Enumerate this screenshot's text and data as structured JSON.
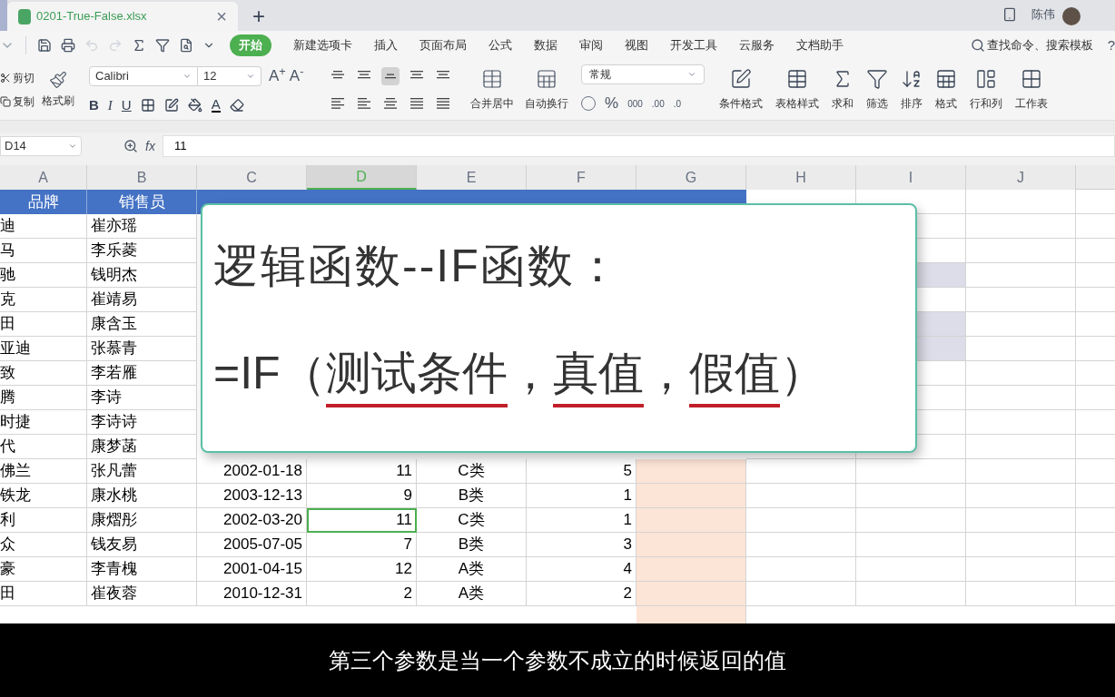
{
  "document_tab": {
    "title": "0201-True-False.xlsx",
    "close": "×"
  },
  "new_tab": "+",
  "user": {
    "name": "陈伟"
  },
  "menu_tabs": [
    {
      "label": "开始",
      "selected": true
    },
    {
      "label": "新建选项卡",
      "selected": false
    },
    {
      "label": "插入",
      "selected": false
    },
    {
      "label": "页面布局",
      "selected": false
    },
    {
      "label": "公式",
      "selected": false
    },
    {
      "label": "数据",
      "selected": false
    },
    {
      "label": "审阅",
      "selected": false
    },
    {
      "label": "视图",
      "selected": false
    },
    {
      "label": "开发工具",
      "selected": false
    },
    {
      "label": "云服务",
      "selected": false
    },
    {
      "label": "文档助手",
      "selected": false
    }
  ],
  "search": {
    "label": "查找命令、搜索模板",
    "help": "?"
  },
  "ribbon": {
    "cut": "剪切",
    "copy": "复制",
    "format_painter": "格式刷",
    "font": "Calibri",
    "font_size": "12",
    "grow": "A$^{+}$",
    "shrink": "A$^{-}$",
    "bold": "B",
    "italic": "I",
    "underline": "U",
    "font_color": "A",
    "align_buttons": [
      {
        "selected": false
      },
      {
        "selected": false
      },
      {
        "selected": true
      },
      {
        "selected": false
      },
      {
        "selected": false
      },
      {
        "selected": false
      },
      {
        "selected": false
      },
      {
        "selected": false
      },
      {
        "selected": false
      },
      {
        "selected": false
      }
    ],
    "merge": "合并居中",
    "wrap": "自动换行",
    "number_format": "常规",
    "percent": "%",
    "thousands": "000",
    "inc_decimal": ".00",
    "dec_decimal": ".0",
    "tools": [
      {
        "label": "条件格式",
        "kind": "conditional"
      },
      {
        "label": "表格样式",
        "kind": "table-style"
      },
      {
        "label": "求和",
        "kind": "sum"
      },
      {
        "label": "筛选",
        "kind": "filter"
      },
      {
        "label": "排序",
        "kind": "sort"
      },
      {
        "label": "格式",
        "kind": "format"
      },
      {
        "label": "行和列",
        "kind": "rows-cols"
      },
      {
        "label": "工作表",
        "kind": "sheet"
      }
    ]
  },
  "formula_bar": {
    "cell_ref": "D14",
    "fx": "fx",
    "value": "11"
  },
  "columns": [
    {
      "label": "A",
      "selected": false
    },
    {
      "label": "B",
      "selected": false
    },
    {
      "label": "C",
      "selected": false
    },
    {
      "label": "D",
      "selected": true
    },
    {
      "label": "E",
      "selected": false
    },
    {
      "label": "F",
      "selected": false
    },
    {
      "label": "G",
      "selected": false
    },
    {
      "label": "H",
      "selected": false
    },
    {
      "label": "I",
      "selected": false
    },
    {
      "label": "J",
      "selected": false
    }
  ],
  "table": {
    "header": [
      "品牌",
      "销售员"
    ],
    "rows": [
      {
        "brand": "迪",
        "seller": "崔亦瑶",
        "shaded": false
      },
      {
        "brand": "马",
        "seller": "李乐菱",
        "shaded": false
      },
      {
        "brand": "驰",
        "seller": "钱明杰",
        "shaded": true
      },
      {
        "brand": "克",
        "seller": "崔靖易",
        "shaded": false
      },
      {
        "brand": "田",
        "seller": "康含玉",
        "shaded": true
      },
      {
        "brand": "亚迪",
        "seller": "张慕青",
        "shaded": true
      },
      {
        "brand": "致",
        "seller": "李若雁",
        "shaded": false
      },
      {
        "brand": "腾",
        "seller": "李诗",
        "shaded": false
      },
      {
        "brand": "时捷",
        "seller": "李诗诗",
        "shaded": false
      },
      {
        "brand": "代",
        "seller": "康梦菡",
        "shaded": false
      },
      {
        "brand": "佛兰",
        "seller": "张凡蕾",
        "date": "2002-01-18",
        "years": "11",
        "level": "C类",
        "rating": "5",
        "selected": false,
        "shaded": false
      },
      {
        "brand": "铁龙",
        "seller": "康水桃",
        "date": "2003-12-13",
        "years": "9",
        "level": "B类",
        "rating": "1",
        "selected": false,
        "shaded": false
      },
      {
        "brand": "利",
        "seller": "康熠彤",
        "date": "2002-03-20",
        "years": "11",
        "level": "C类",
        "rating": "1",
        "selected": true,
        "shaded": false
      },
      {
        "brand": "众",
        "seller": "钱友易",
        "date": "2005-07-05",
        "years": "7",
        "level": "B类",
        "rating": "3",
        "selected": false,
        "shaded": false
      },
      {
        "brand": "豪",
        "seller": "李青槐",
        "date": "2001-04-15",
        "years": "12",
        "level": "A类",
        "rating": "4",
        "selected": false,
        "shaded": false
      },
      {
        "brand": "田",
        "seller": "崔夜蓉",
        "date": "2010-12-31",
        "years": "2",
        "level": "A类",
        "rating": "2",
        "selected": false,
        "shaded": false
      }
    ]
  },
  "overlay": {
    "title": "逻辑函数--IF函数：",
    "formula": [
      {
        "text": "=IF（",
        "underlined": false
      },
      {
        "text": "测试条件",
        "underlined": true
      },
      {
        "text": "，",
        "underlined": false
      },
      {
        "text": "真值",
        "underlined": true
      },
      {
        "text": "，",
        "underlined": false
      },
      {
        "text": "假值",
        "underlined": true
      },
      {
        "text": "）",
        "underlined": false
      }
    ]
  },
  "subtitle": "第三个参数是当一个参数不成立的时候返回的值"
}
